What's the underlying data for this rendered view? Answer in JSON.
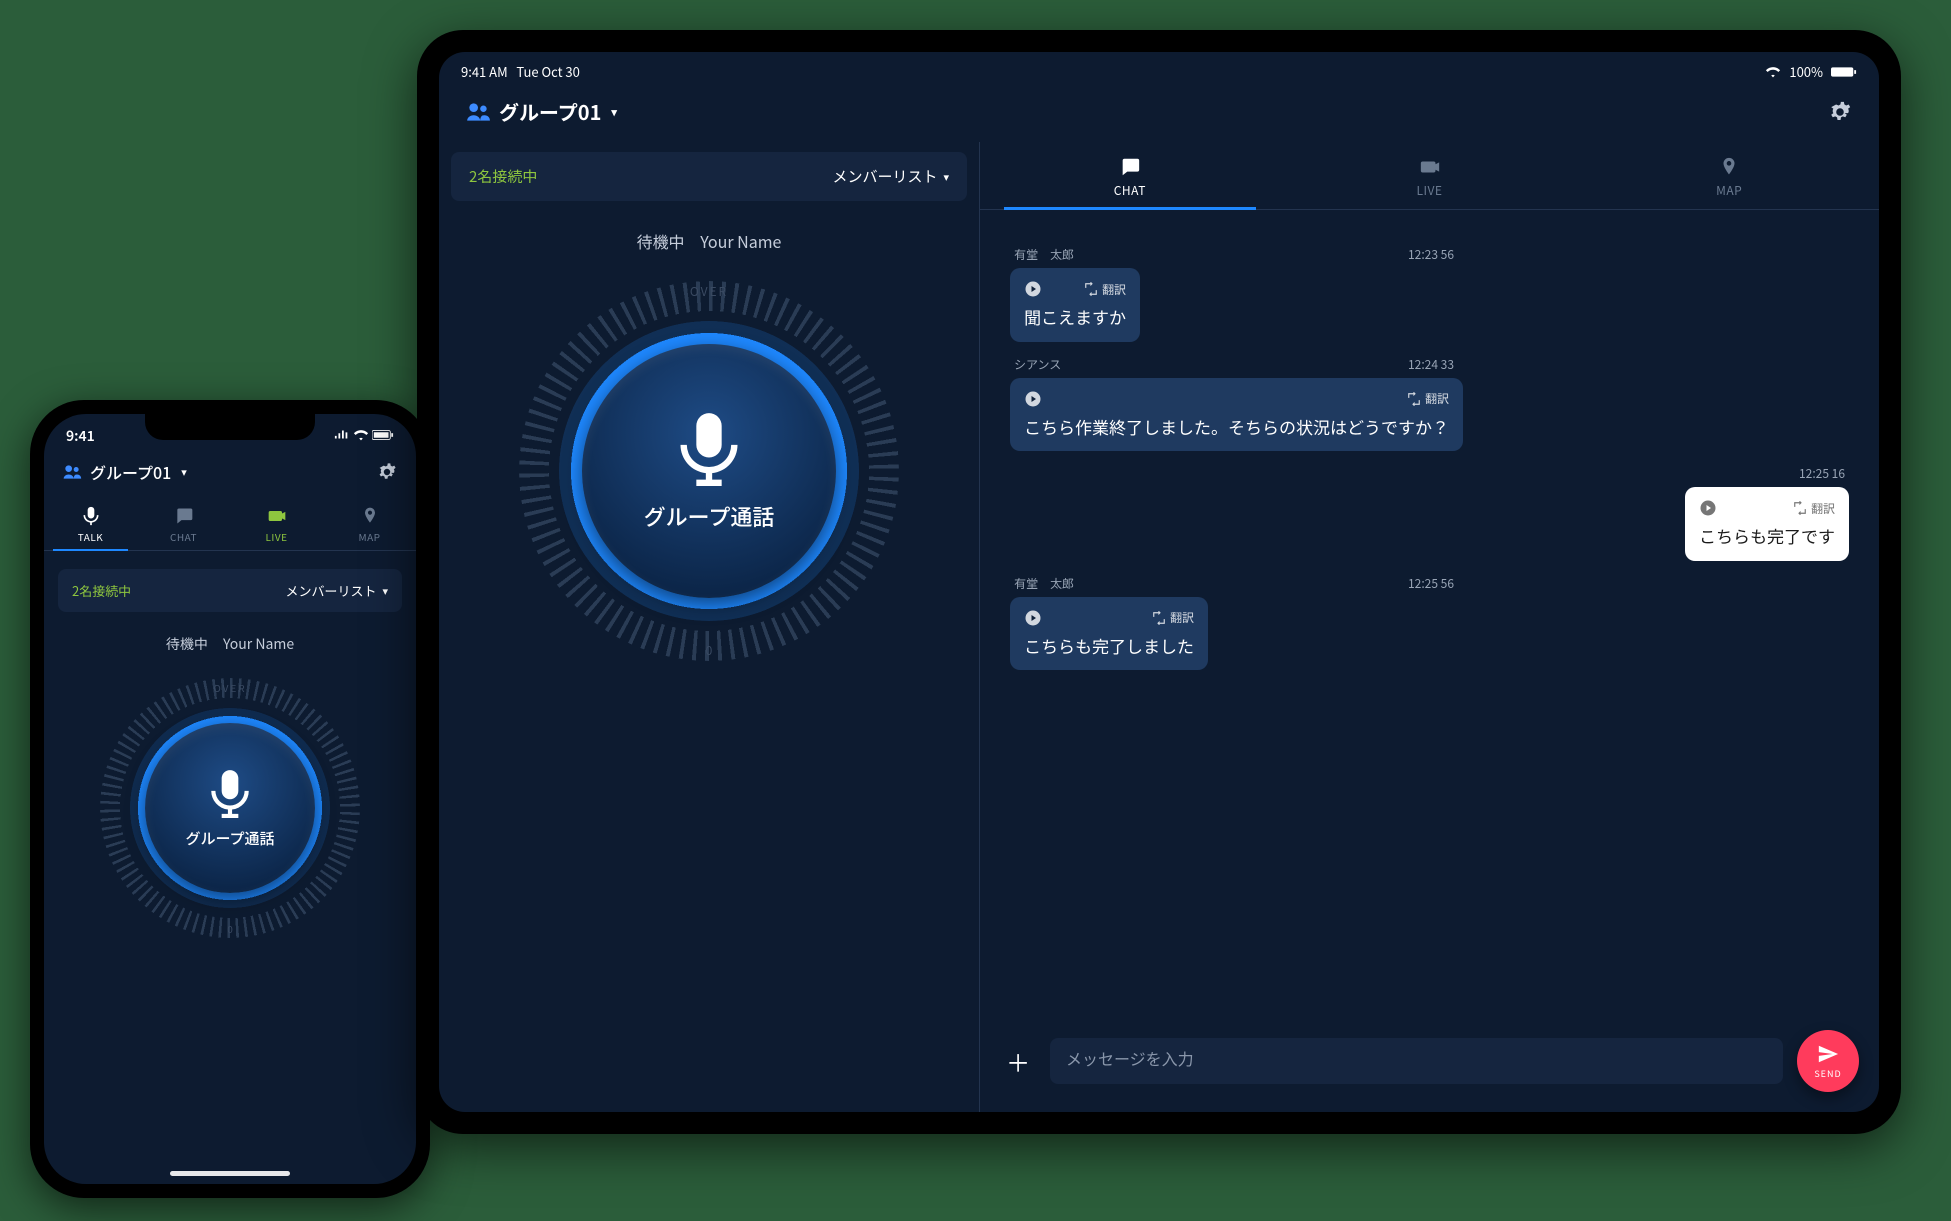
{
  "phone": {
    "status_time": "9:41",
    "group_name": "グループ01",
    "tabs": {
      "talk": "TALK",
      "chat": "CHAT",
      "live": "LIVE",
      "map": "MAP"
    },
    "conn_count": "2名接続中",
    "member_list": "メンバーリスト",
    "wait_state": "待機中",
    "your_name": "Your Name",
    "over": "OVER",
    "zero": "0",
    "talk_label": "グループ通話"
  },
  "tablet": {
    "status_time": "9:41 AM",
    "status_date": "Tue Oct 30",
    "battery": "100%",
    "group_name": "グループ01",
    "conn_count": "2名接続中",
    "member_list": "メンバーリスト",
    "wait_state": "待機中",
    "your_name": "Your Name",
    "over": "OVER",
    "zero": "0",
    "talk_label": "グループ通話",
    "tabs": {
      "chat": "CHAT",
      "live": "LIVE",
      "map": "MAP"
    },
    "translate_label": "翻訳",
    "messages": [
      {
        "sender": "有堂　太郎",
        "time": "12:23 56",
        "text": "聞こえますか",
        "me": false
      },
      {
        "sender": "シアンス",
        "time": "12:24 33",
        "text": "こちら作業終了しました。そちらの状況はどうですか？",
        "me": false
      },
      {
        "sender": "",
        "time": "12:25 16",
        "text": "こちらも完了です",
        "me": true
      },
      {
        "sender": "有堂　太郎",
        "time": "12:25 56",
        "text": "こちらも完了しました",
        "me": false
      }
    ],
    "composer_placeholder": "メッセージを入力",
    "send_label": "SEND"
  }
}
